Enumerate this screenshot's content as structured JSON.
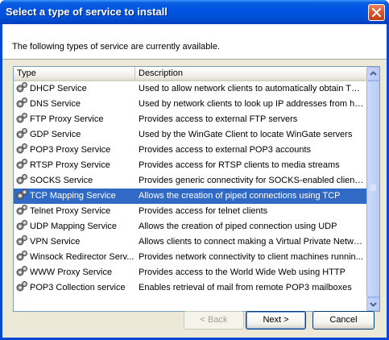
{
  "window": {
    "title": "Select a type of service to install"
  },
  "intro_text": "The following types of service are currently available.",
  "list": {
    "columns": [
      "Type",
      "Description"
    ],
    "rows": [
      {
        "type": "DHCP Service",
        "description": "Used to allow network clients to automatically obtain TC...",
        "selected": false
      },
      {
        "type": "DNS Service",
        "description": "Used by network clients to look up IP addresses from ho...",
        "selected": false
      },
      {
        "type": "FTP Proxy Service",
        "description": "Provides access to external FTP servers",
        "selected": false
      },
      {
        "type": "GDP Service",
        "description": "Used by the WinGate Client to locate WinGate servers",
        "selected": false
      },
      {
        "type": "POP3 Proxy Service",
        "description": "Provides access to external POP3 accounts",
        "selected": false
      },
      {
        "type": "RTSP Proxy Service",
        "description": "Provides access for RTSP clients to media streams",
        "selected": false
      },
      {
        "type": "SOCKS Service",
        "description": "Provides generic connectivity for SOCKS-enabled client ...",
        "selected": false
      },
      {
        "type": "TCP Mapping Service",
        "description": "Allows the creation of piped connections using TCP",
        "selected": true
      },
      {
        "type": "Telnet Proxy Service",
        "description": "Provides access for telnet clients",
        "selected": false
      },
      {
        "type": "UDP Mapping Service",
        "description": "Allows the creation of piped connection using UDP",
        "selected": false
      },
      {
        "type": "VPN Service",
        "description": "Allows clients to connect making a Virtual Private Network",
        "selected": false
      },
      {
        "type": "Winsock Redirector Serv...",
        "description": "Provides network connectivity to client machines runnin...",
        "selected": false
      },
      {
        "type": "WWW Proxy Service",
        "description": "Provides access to the World Wide Web using HTTP",
        "selected": false
      },
      {
        "type": "POP3 Collection service",
        "description": "Enables retrieval of mail from remote POP3 mailboxes",
        "selected": false
      }
    ]
  },
  "buttons": {
    "back": "< Back",
    "next": "Next >",
    "cancel": "Cancel"
  },
  "icons": {
    "row_icon": "gear-icon",
    "close": "close-icon",
    "scroll_up": "chevron-up-icon",
    "scroll_down": "chevron-down-icon"
  },
  "colors": {
    "title_bar": "#0054e3",
    "selection": "#316ac5",
    "close_button": "#d8532c",
    "dialog_face": "#ece9d8"
  }
}
